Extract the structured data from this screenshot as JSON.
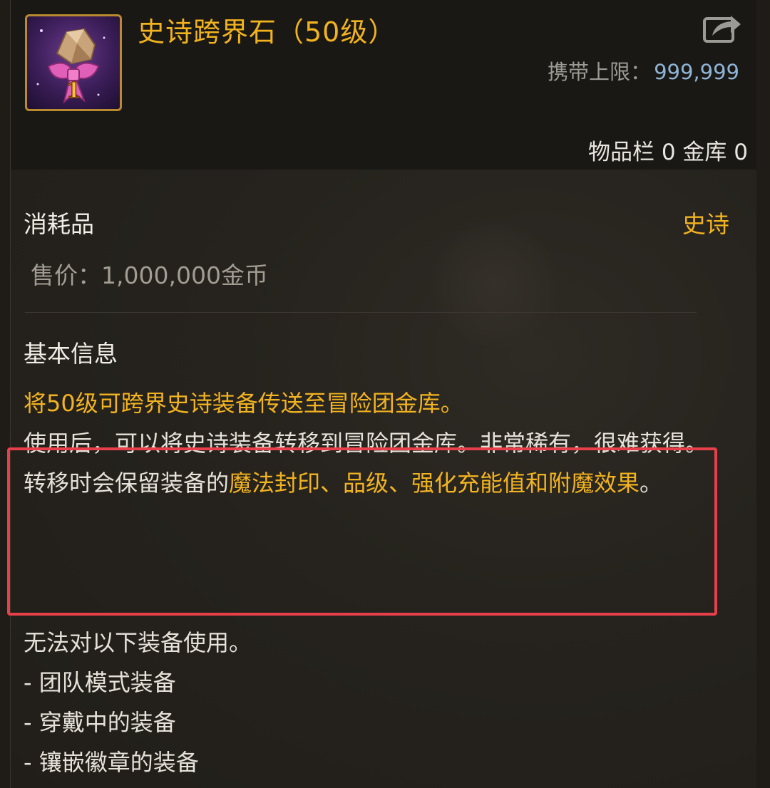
{
  "item": {
    "title": "史诗跨界石（50级）",
    "icon": "epic-stone-gift-icon",
    "icon_badge": "1",
    "carry_limit_label": "携带上限：",
    "carry_limit_value": "999,999",
    "storage_text": "物品栏 0 金库 0"
  },
  "meta": {
    "category": "消耗品",
    "rarity": "史诗",
    "price": "售价：1,000,000金币"
  },
  "info": {
    "section_title": "基本信息",
    "line1": "将50级可跨界史诗装备传送至冒险团金库。",
    "line2": "使用后，可以将史诗装备转移到冒险团金库。非常稀有，很难获得。",
    "line3_prefix": "转移时会保留装备的",
    "line3_highlight": "魔法封印、品级、强化充能值和附魔效果",
    "line3_suffix": "。"
  },
  "restrictions": {
    "title": "无法对以下装备使用。",
    "items": [
      "- 团队模式装备",
      "- 穿戴中的装备",
      "- 镶嵌徽章的装备"
    ]
  },
  "colors": {
    "accent": "#f2b320",
    "value_blue": "#8eb4d6",
    "annotation_red": "#e8404a",
    "background": "#26231e"
  }
}
